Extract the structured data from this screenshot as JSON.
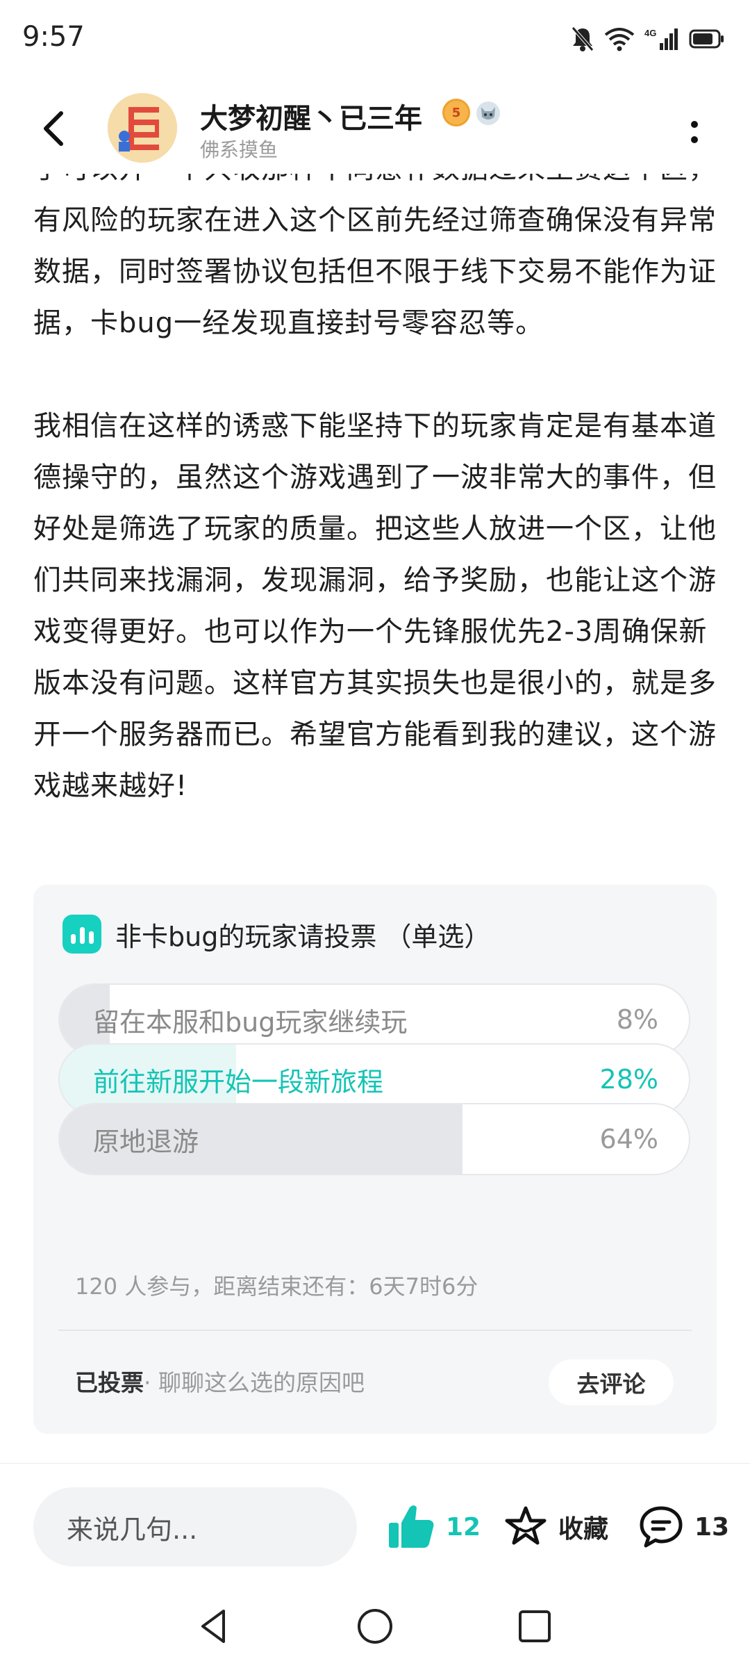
{
  "status_bar": {
    "time": "9:57",
    "network_label": "4G",
    "icons": [
      "mute-bell-icon",
      "wifi-icon",
      "signal-icon",
      "battery-icon"
    ]
  },
  "header": {
    "author_name": "大梦初醒丶已三年",
    "level_badge": "5",
    "author_subtitle": "佛系摸鱼"
  },
  "article": {
    "paragraph_1": "手可以开一个只收那种不同意补数据过来至赛这个区，有风险的玩家在进入这个区前先经过筛查确保没有异常数据，同时签署协议包括但不限于线下交易不能作为证据，卡bug一经发现直接封号零容忍等。",
    "paragraph_2": "我相信在这样的诱惑下能坚持下的玩家肯定是有基本道德操守的，虽然这个游戏遇到了一波非常大的事件，但好处是筛选了玩家的质量。把这些人放进一个区，让他们共同来找漏洞，发现漏洞，给予奖励，也能让这个游戏变得更好。也可以作为一个先锋服优先2-3周确保新版本没有问题。这样官方其实损失也是很小的，就是多开一个服务器而已。希望官方能看到我的建议，这个游戏越来越好!"
  },
  "poll": {
    "title": "非卡bug的玩家请投票 （单选）",
    "options": [
      {
        "label": "留在本服和bug玩家继续玩",
        "percent_text": "8%",
        "percent": 8,
        "selected": false
      },
      {
        "label": "前往新服开始一段新旅程",
        "percent_text": "28%",
        "percent": 28,
        "selected": true
      },
      {
        "label": "原地退游",
        "percent_text": "64%",
        "percent": 64,
        "selected": false
      }
    ],
    "meta": "120 人参与，距离结束还有：6天7时6分",
    "voted_label": "已投票",
    "voted_hint": "· 聊聊这么选的原因吧",
    "comment_button": "去评论",
    "accent_color": "#14c4b4"
  },
  "action_bar": {
    "comment_placeholder": "来说几句...",
    "like_count": "12",
    "favorite_label": "收藏",
    "comment_count": "13"
  }
}
